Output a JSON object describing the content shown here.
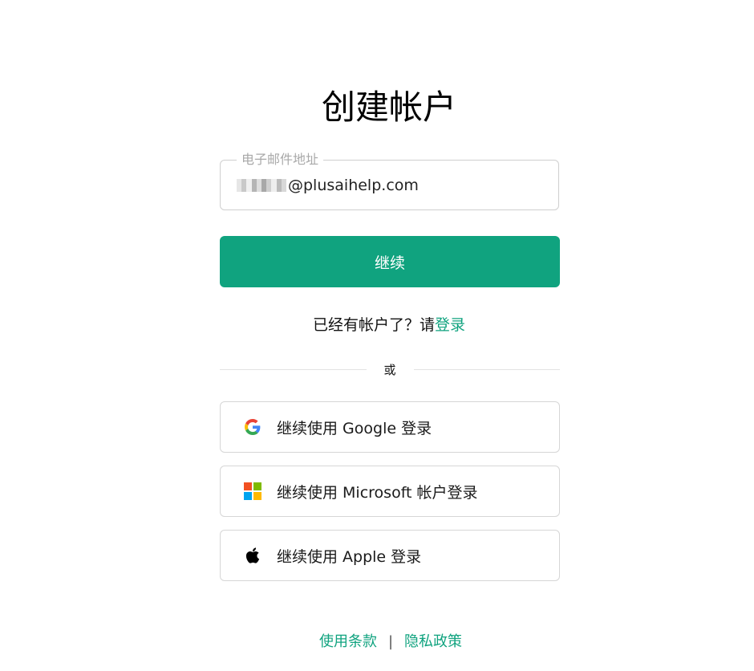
{
  "title": "创建帐户",
  "email": {
    "legend": "电子邮件地址",
    "value": "@plusaihelp.com"
  },
  "continue_label": "继续",
  "login_prompt": {
    "text": "已经有帐户了？请",
    "link": "登录"
  },
  "divider_text": "或",
  "social": [
    {
      "label": "继续使用 Google 登录",
      "icon": "google-icon"
    },
    {
      "label": "继续使用 Microsoft 帐户登录",
      "icon": "microsoft-icon"
    },
    {
      "label": "继续使用 Apple 登录",
      "icon": "apple-icon"
    }
  ],
  "footer": {
    "terms": "使用条款",
    "separator": "|",
    "privacy": "隐私政策"
  },
  "colors": {
    "accent": "#10a37f"
  }
}
